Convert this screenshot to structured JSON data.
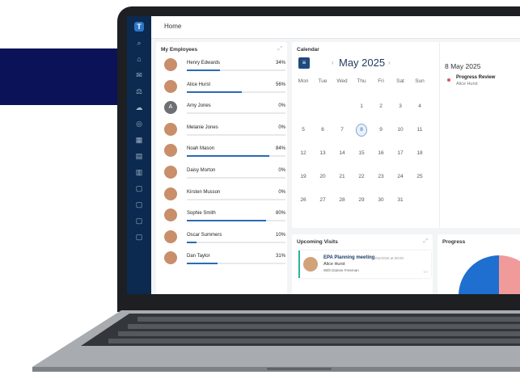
{
  "app": {
    "logo_letter": "T",
    "page_title": "Home"
  },
  "sidebar": {
    "icons": [
      "search-icon",
      "home-icon",
      "mail-icon",
      "scales-icon",
      "cloud-icon",
      "rss-icon",
      "building-icon",
      "calendar-icon",
      "calendar-grid-icon",
      "document-icon",
      "document-check-icon",
      "document-list-icon",
      "document-alt-icon"
    ]
  },
  "employees": {
    "title": "My Employees",
    "items": [
      {
        "name": "Henry Edwards",
        "percent_label": "34%",
        "progress": 0.34
      },
      {
        "name": "Alice Hurst",
        "percent_label": "56%",
        "progress": 0.56
      },
      {
        "name": "Amy Jones",
        "percent_label": "0%",
        "progress": 0.0,
        "initial": "A"
      },
      {
        "name": "Melanie Jones",
        "percent_label": "0%",
        "progress": 0.0
      },
      {
        "name": "Noah Mason",
        "percent_label": "84%",
        "progress": 0.84
      },
      {
        "name": "Daisy Morton",
        "percent_label": "0%",
        "progress": 0.0
      },
      {
        "name": "Kirsten Musson",
        "percent_label": "0%",
        "progress": 0.0
      },
      {
        "name": "Sophie Smith",
        "percent_label": "80%",
        "progress": 0.8
      },
      {
        "name": "Oscar Summers",
        "percent_label": "10%",
        "progress": 0.1
      },
      {
        "name": "Dan Taylor",
        "percent_label": "31%",
        "progress": 0.31
      }
    ]
  },
  "calendar": {
    "title": "Calendar",
    "month": "May 2025",
    "prev": "‹",
    "next": "›",
    "weekdays": [
      "Mon",
      "Tue",
      "Wed",
      "Thu",
      "Fri",
      "Sat",
      "Sun"
    ],
    "weeks": [
      [
        "",
        "",
        "",
        "1",
        "2",
        "3",
        "4"
      ],
      [
        "5",
        "6",
        "7",
        "8",
        "9",
        "10",
        "11"
      ],
      [
        "12",
        "13",
        "14",
        "15",
        "16",
        "17",
        "18"
      ],
      [
        "19",
        "20",
        "21",
        "22",
        "23",
        "24",
        "25"
      ],
      [
        "26",
        "27",
        "28",
        "29",
        "30",
        "31",
        ""
      ]
    ],
    "selected_day": "8"
  },
  "agenda": {
    "date": "8 May 2025",
    "events": [
      {
        "title": "Progress Review",
        "person": "Alice Hurst",
        "color": "#e2525d"
      }
    ]
  },
  "visits": {
    "title": "Upcoming Visits",
    "items": [
      {
        "title": "EPA Planning meeting",
        "when": "22/02/2026 at 09:00",
        "person": "Alice Hurst",
        "with": "With Dianne Freeman"
      }
    ]
  },
  "progress": {
    "title": "Progress",
    "colors": {
      "primary": "#1f6fd1",
      "secondary": "#f19a9a"
    }
  },
  "colors": {
    "navy_banner": "#0b1257",
    "sidebar": "#0c2a4f",
    "accent": "#2a6bb5"
  }
}
